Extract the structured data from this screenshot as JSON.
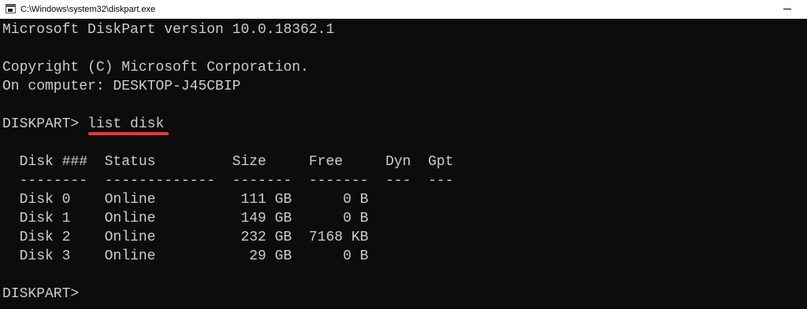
{
  "window": {
    "title": "C:\\Windows\\system32\\diskpart.exe"
  },
  "console": {
    "version_line": "Microsoft DiskPart version 10.0.18362.1",
    "copyright_line": "Copyright (C) Microsoft Corporation.",
    "computer_line": "On computer: DESKTOP-J45CBIP",
    "prompt": "DISKPART> ",
    "command": "list disk",
    "table_header": "  Disk ###  Status         Size     Free     Dyn  Gpt",
    "table_separator": "  --------  -------------  -------  -------  ---  ---",
    "rows": [
      "  Disk 0    Online          111 GB      0 B",
      "  Disk 1    Online          149 GB      0 B",
      "  Disk 2    Online          232 GB  7168 KB",
      "  Disk 3    Online           29 GB      0 B"
    ],
    "final_prompt": "DISKPART>"
  },
  "colors": {
    "console_bg": "#0c0c0c",
    "console_text": "#cccccc",
    "highlight_underline": "#e8383d"
  }
}
